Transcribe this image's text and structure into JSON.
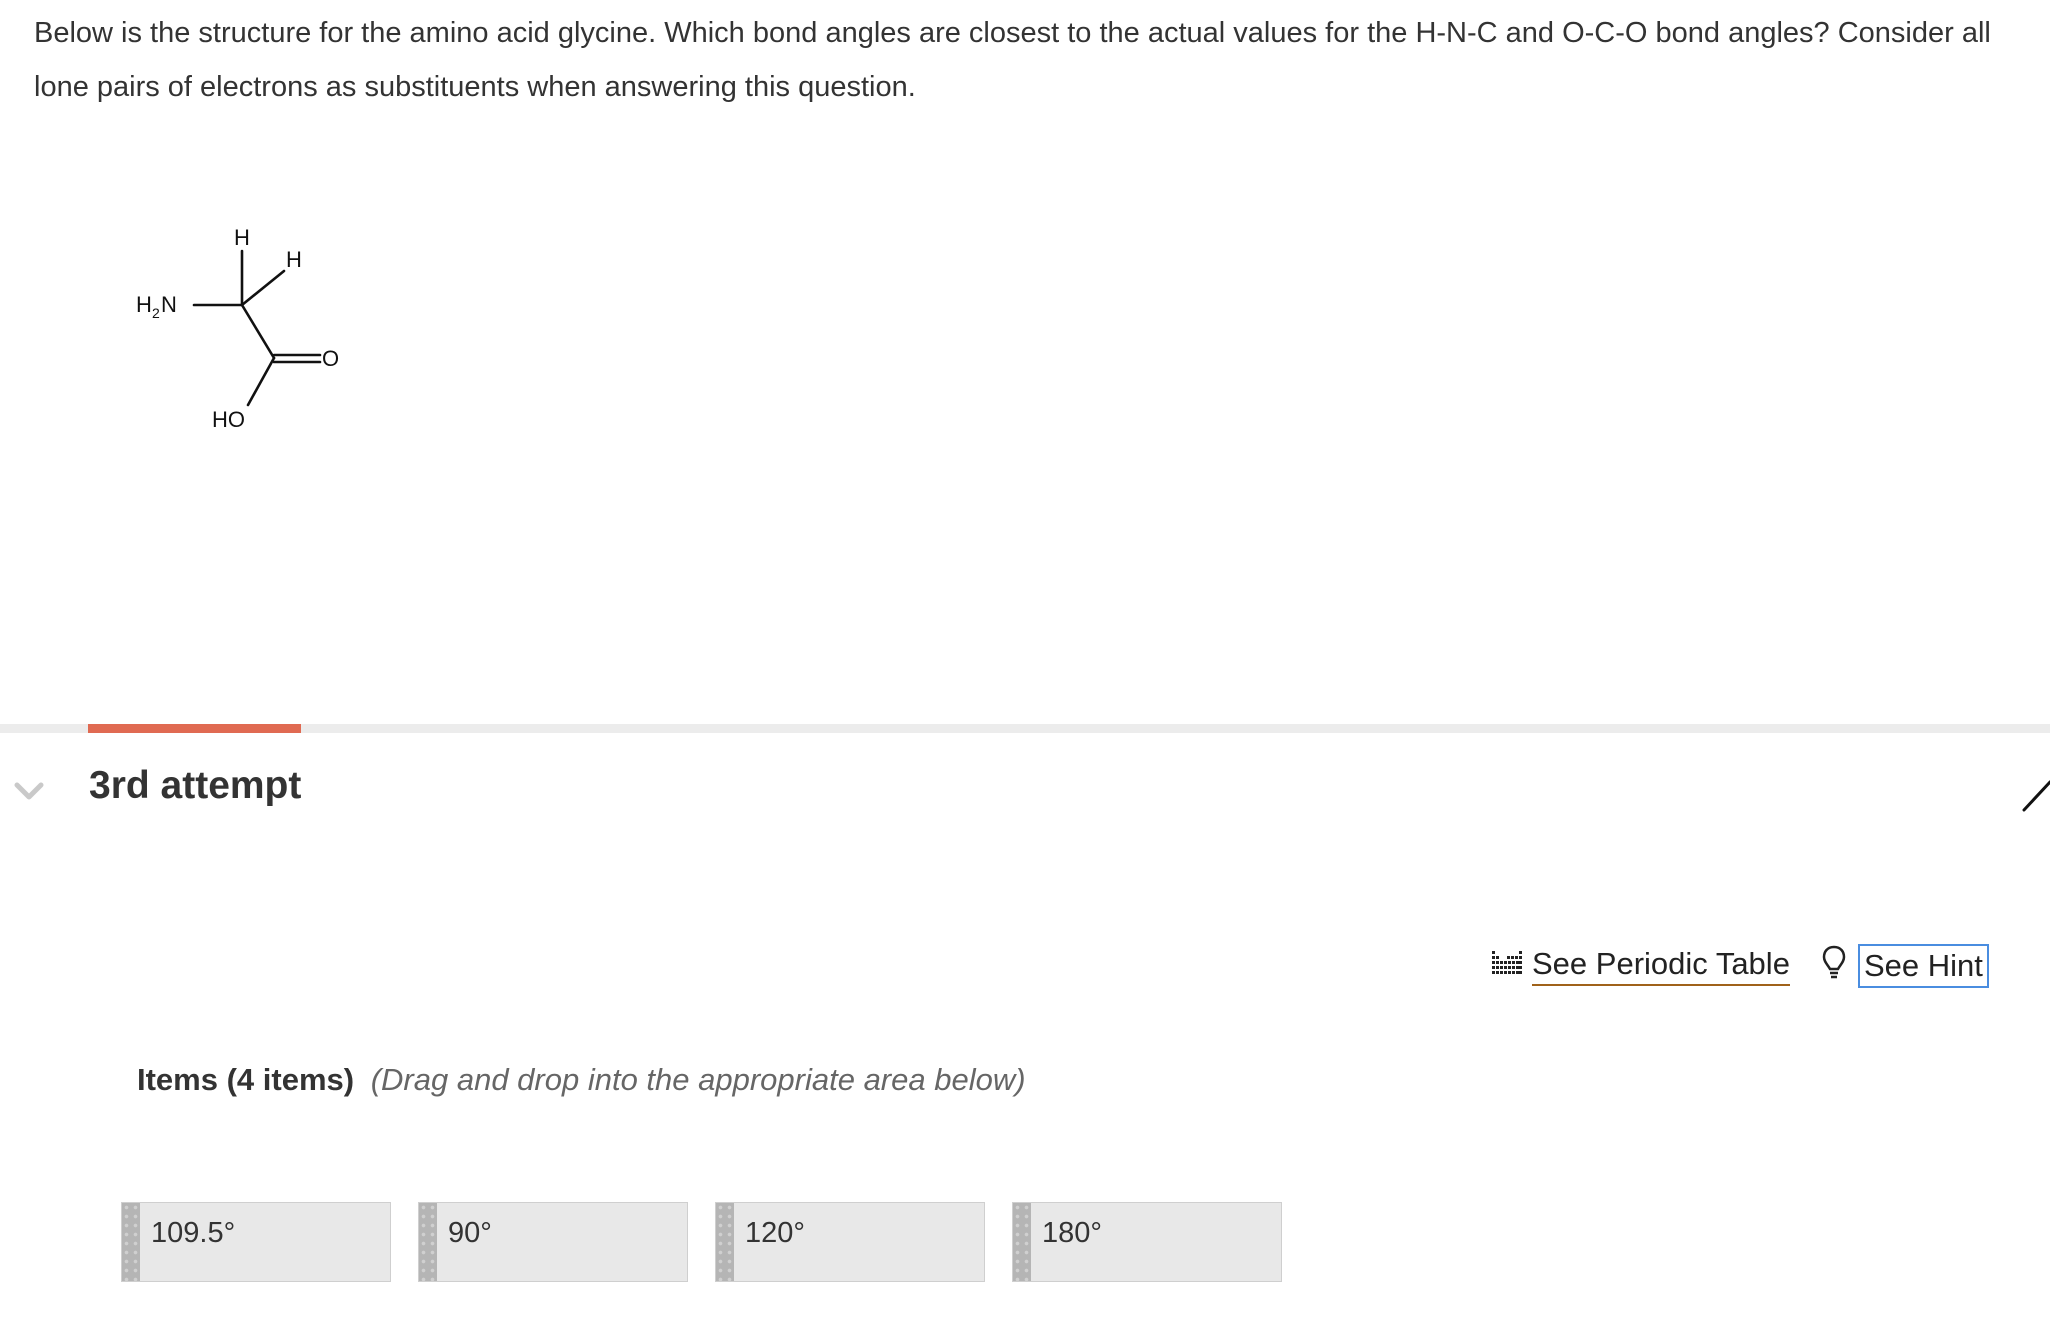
{
  "question": {
    "text": "Below is the structure for the amino acid glycine. Which bond angles are closest to the actual values for the H-N-C and O-C-O bond angles? Consider all lone pairs of electrons as substituents when answering this question."
  },
  "molecule": {
    "labels": {
      "h_top": "H",
      "h_right": "H",
      "amine_h": "H",
      "amine_sub": "2",
      "amine_n": "N",
      "carbonyl_o": "O",
      "hydroxyl": "HO"
    }
  },
  "attempt": {
    "title": "3rd attempt",
    "progress_color": "#e06a52"
  },
  "toolbar": {
    "periodic_table_label": "See Periodic Table",
    "hint_label": "See Hint"
  },
  "items": {
    "heading": "Items (4 items)",
    "instruction": "(Drag and drop into the appropriate area below)",
    "list": [
      {
        "label": "109.5°"
      },
      {
        "label": "90°"
      },
      {
        "label": "120°"
      },
      {
        "label": "180°"
      }
    ]
  },
  "icons": {
    "collapse": "chevron-down-icon",
    "periodic": "periodic-table-icon",
    "hint": "lightbulb-icon",
    "edit": "pencil-icon"
  },
  "colors": {
    "accent": "#e06a52",
    "link_underline": "#a0621a",
    "focus_outline": "#4a8de0"
  }
}
